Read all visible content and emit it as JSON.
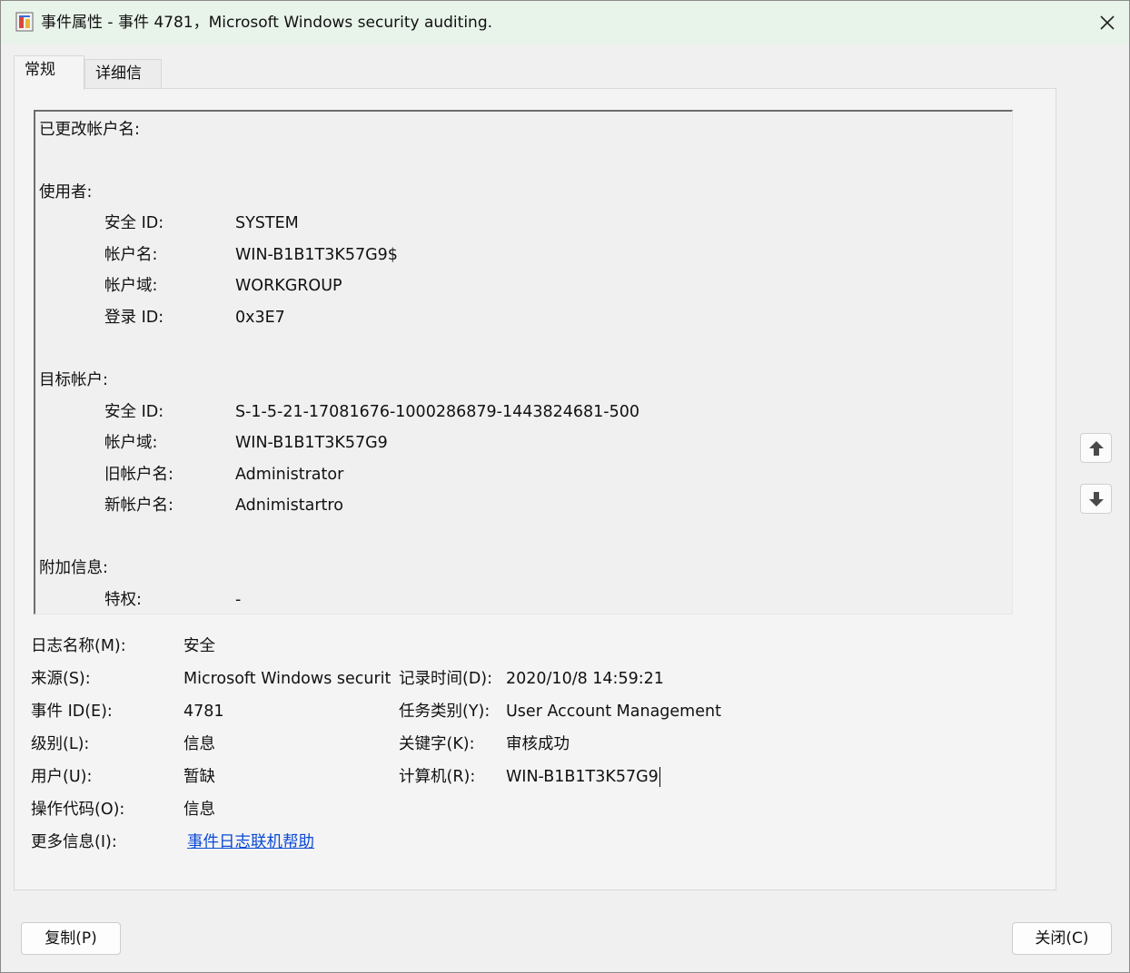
{
  "window": {
    "title": "事件属性 - 事件 4781，Microsoft Windows security auditing."
  },
  "tabs": [
    {
      "label": "常规"
    },
    {
      "label": "详细信息"
    }
  ],
  "description": {
    "heading": "已更改帐户名:",
    "subject": {
      "heading": "使用者:",
      "fields": [
        {
          "label": "安全 ID:",
          "value": "SYSTEM"
        },
        {
          "label": "帐户名:",
          "value": "WIN-B1B1T3K57G9$"
        },
        {
          "label": "帐户域:",
          "value": "WORKGROUP"
        },
        {
          "label": "登录 ID:",
          "value": "0x3E7"
        }
      ]
    },
    "target": {
      "heading": "目标帐户:",
      "fields": [
        {
          "label": "安全 ID:",
          "value": "S-1-5-21-17081676-1000286879-1443824681-500"
        },
        {
          "label": "帐户域:",
          "value": "WIN-B1B1T3K57G9"
        },
        {
          "label": "旧帐户名:",
          "value": "Administrator"
        },
        {
          "label": "新帐户名:",
          "value": "Adnimistartro"
        }
      ]
    },
    "additional": {
      "heading": "附加信息:",
      "fields": [
        {
          "label": "特权:",
          "value": "-"
        }
      ]
    }
  },
  "info": {
    "log_name": {
      "label": "日志名称(M):",
      "value": "安全"
    },
    "source": {
      "label": "来源(S):",
      "value": "Microsoft Windows security"
    },
    "logged": {
      "label": "记录时间(D):",
      "value": "2020/10/8 14:59:21"
    },
    "event_id": {
      "label": "事件 ID(E):",
      "value": "4781"
    },
    "task_category": {
      "label": "任务类别(Y):",
      "value": "User Account Management"
    },
    "level": {
      "label": "级别(L):",
      "value": "信息"
    },
    "keywords": {
      "label": "关键字(K):",
      "value": "审核成功"
    },
    "user": {
      "label": "用户(U):",
      "value": "暂缺"
    },
    "computer": {
      "label": "计算机(R):",
      "value": "WIN-B1B1T3K57G9"
    },
    "opcode": {
      "label": "操作代码(O):",
      "value": "信息"
    },
    "more_info": {
      "label": "更多信息(I):",
      "link": "事件日志联机帮助"
    }
  },
  "buttons": {
    "copy": "复制(P)",
    "close": "关闭(C)"
  },
  "icons": {
    "app": "event-properties-icon",
    "close": "close-icon",
    "up": "arrow-up-icon",
    "down": "arrow-down-icon"
  }
}
